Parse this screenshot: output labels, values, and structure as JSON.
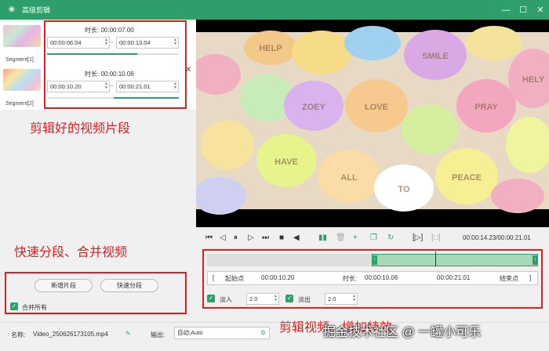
{
  "window": {
    "title": "高级剪辑"
  },
  "segments": [
    {
      "name": "Segment[1]",
      "duration_label": "时长:",
      "duration": "00:00:07.00",
      "start": "00:00:06.04",
      "end": "00:00:13.04"
    },
    {
      "name": "Segment[2]",
      "duration_label": "时长:",
      "duration": "00:00:10.06",
      "start": "00:00:10.20",
      "end": "00:00:21.01"
    }
  ],
  "annotations": {
    "clips": "剪辑好的视频片段",
    "split_merge": "快速分段、合并视频",
    "edit_effects": "剪辑视频、增加特效"
  },
  "left_buttons": {
    "add_segment": "新增片段",
    "quick_split": "快速分段"
  },
  "merge_all": {
    "label": "合并所有",
    "checked": true
  },
  "playback": {
    "time": "00:00:14.23/00:00:21.01"
  },
  "trim": {
    "start_btn": "起始点",
    "start_value": "00:00:10.20",
    "duration_label": "时长:",
    "duration_value": "00:00:10.06",
    "end_value": "00:00:21.01",
    "end_btn": "结束点"
  },
  "effects": {
    "fade_in_label": "淡入",
    "fade_in_value": "2.0",
    "fade_out_label": "淡出",
    "fade_out_value": "2.0"
  },
  "bottom": {
    "name_label": "名称:",
    "name_value": "Video_250626173105.mp4",
    "output_label": "输出:",
    "output_value": "自动;Auto"
  },
  "watermark": "掘金技术社区 @ 一罐小可乐",
  "candy_texts": [
    "SMILE",
    "LOVE",
    "ZOEY",
    "HELP",
    "PRAY",
    "HAVE",
    "HELY",
    "PEACE",
    "ALL",
    "TO"
  ]
}
